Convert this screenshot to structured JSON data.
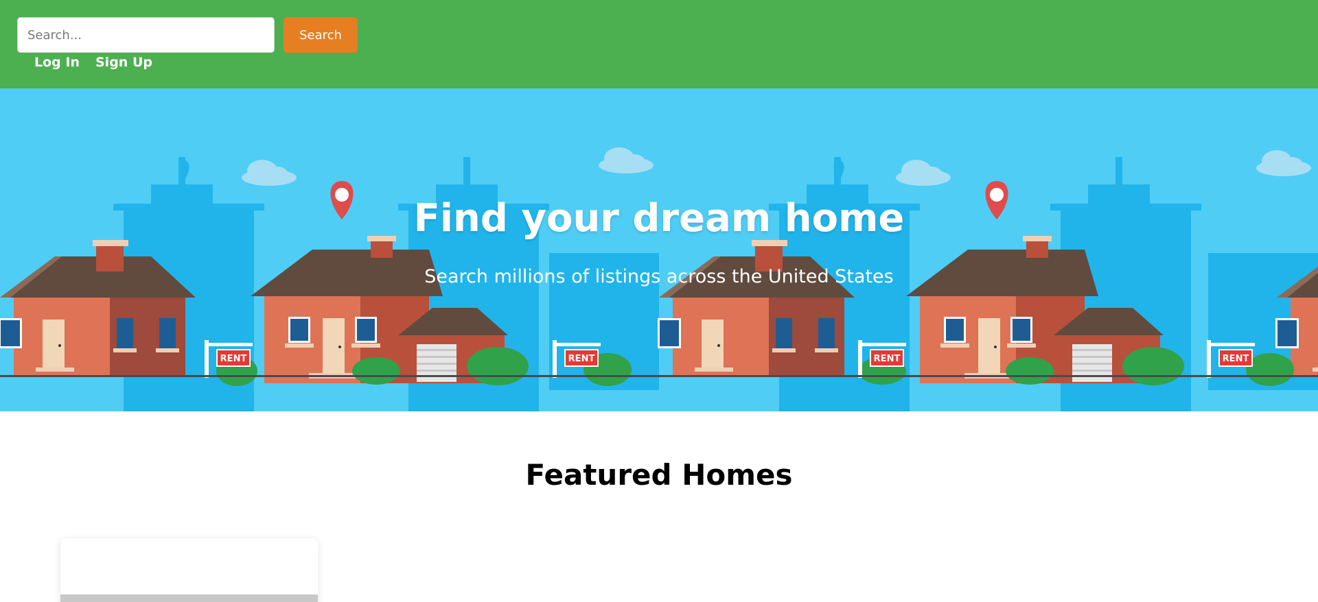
{
  "header": {
    "search": {
      "placeholder": "Search...",
      "value": ""
    },
    "search_button_label": "Search",
    "nav": {
      "login": "Log In",
      "signup": "Sign Up"
    }
  },
  "hero": {
    "title": "Find your dream home",
    "subtitle": "Search millions of listings across the United States",
    "sign_text": "RENT"
  },
  "featured": {
    "title": "Featured Homes"
  },
  "colors": {
    "header_bg": "#4caf50",
    "accent": "#e67e22",
    "hero_bg": "#4fcdf5"
  }
}
